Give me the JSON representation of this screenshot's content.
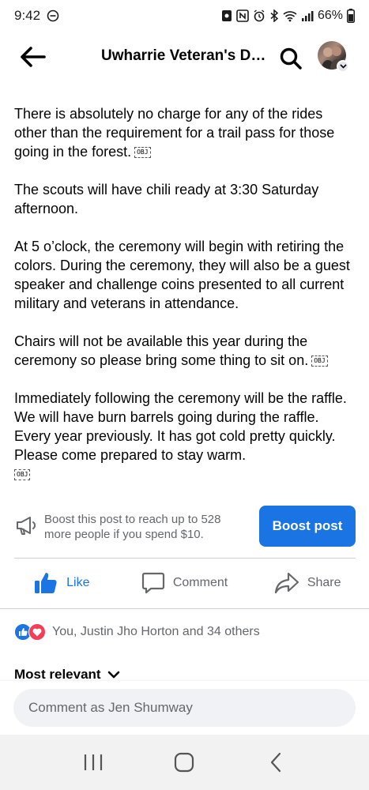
{
  "status_bar": {
    "time": "9:42",
    "battery": "66%"
  },
  "header": {
    "title": "Uwharrie Veteran's Da..."
  },
  "post": {
    "paragraphs": [
      "There is absolutely no charge for any of the rides other than the requirement for a trail pass for those going in the forest.",
      "The scouts will have chili ready at 3:30 Saturday afternoon.",
      "At 5 o’clock, the ceremony will begin with retiring the colors. During the ceremony, they will also be a guest speaker and challenge coins presented to all current military and veterans in attendance.",
      "Chairs will not be available this year during the ceremony so please bring some thing to sit on.",
      "Immediately following the ceremony will be the raffle. We will have burn barrels going during the raffle. Every year previously. It has got cold pretty quickly. Please come prepared to stay warm."
    ],
    "obj_marker": "OBJ"
  },
  "boost": {
    "text": "Boost this post to reach up to 528 more people if you spend $10.",
    "button_label": "Boost post"
  },
  "actions": {
    "like_label": "Like",
    "comment_label": "Comment",
    "share_label": "Share"
  },
  "reactions": {
    "summary": "You, Justin Jho Horton and 34 others"
  },
  "comments": {
    "sort_label": "Most relevant",
    "input_placeholder": "Comment as Jen Shumway"
  },
  "colors": {
    "accent": "#1b74e4",
    "love": "#f33e58",
    "secondary_text": "#65676b"
  }
}
